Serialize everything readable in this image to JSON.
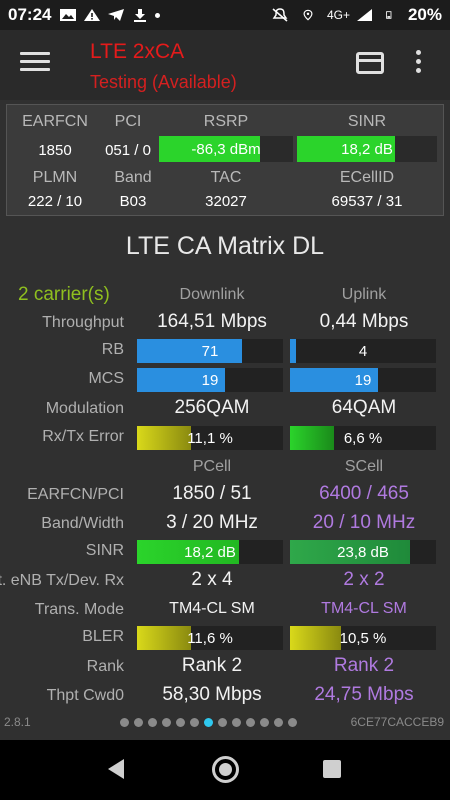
{
  "status_bar": {
    "time": "07:24",
    "network": "4G+",
    "battery": "20%",
    "icons": [
      "image-icon",
      "warning-icon",
      "telegram-icon",
      "download-icon",
      "dot-icon",
      "mute-icon",
      "location-icon",
      "signal-icon",
      "battery-icon"
    ]
  },
  "app_bar": {
    "title": "LTE 2xCA",
    "subtitle": "Testing (Available)",
    "title_color": "#e51b1b"
  },
  "panel": {
    "earfcn_label": "EARFCN",
    "earfcn": "1850",
    "pci_label": "PCI",
    "pci": "051 / 0",
    "rsrp_label": "RSRP",
    "rsrp": "-86,3 dBm",
    "rsrp_level": 0.75,
    "sinr_label": "SINR",
    "sinr": "18,2 dB",
    "sinr_level": 0.7,
    "plmn_label": "PLMN",
    "plmn": "222 / 10",
    "band_label": "Band",
    "band": "B03",
    "tac_label": "TAC",
    "tac": "32027",
    "ecellid_label": "ECellID",
    "ecellid": "69537 / 31"
  },
  "matrix": {
    "title": "LTE CA Matrix DL",
    "carriers": "2 carrier(s)",
    "col_downlink": "Downlink",
    "col_uplink": "Uplink",
    "throughput_label": "Throughput",
    "throughput_dl": "164,51 Mbps",
    "throughput_ul": "0,44 Mbps",
    "rb_label": "RB",
    "rb_dl": "71",
    "rb_dl_level": 0.72,
    "rb_ul": "4",
    "rb_ul_level": 0.04,
    "mcs_label": "MCS",
    "mcs_dl": "19",
    "mcs_dl_level": 0.6,
    "mcs_ul": "19",
    "mcs_ul_level": 0.6,
    "modulation_label": "Modulation",
    "modulation_dl": "256QAM",
    "modulation_ul": "64QAM",
    "error_label": "Rx/Tx Error",
    "error_dl": "11,1 %",
    "error_dl_level": 0.37,
    "error_ul": "6,6 %",
    "error_ul_level": 0.3,
    "col_pcell": "PCell",
    "col_scell": "SCell",
    "earfcn_pci_label": "EARFCN/PCI",
    "earfcn_pci_p": "1850 / 51",
    "earfcn_pci_s": "6400 / 465",
    "band_width_label": "Band/Width",
    "band_width_p": "3 / 20 MHz",
    "band_width_s": "20 / 10 MHz",
    "sinr_label": "SINR",
    "sinr_p": "18,2 dB",
    "sinr_p_level": 0.7,
    "sinr_s": "23,8 dB",
    "sinr_s_level": 0.82,
    "enb_label": "Ant. eNB Tx/Dev. Rx",
    "enb_p": "2 x 4",
    "enb_s": "2 x 2",
    "trans_mode_label": "Trans. Mode",
    "trans_mode_p": "TM4-CL SM",
    "trans_mode_s": "TM4-CL SM",
    "bler_label": "BLER",
    "bler_p": "11,6 %",
    "bler_p_level": 0.37,
    "bler_s": "10,5 %",
    "bler_s_level": 0.35,
    "rank_label": "Rank",
    "rank_p": "Rank 2",
    "rank_s": "Rank 2",
    "cwd0_label": "Thpt Cwd0",
    "cwd0_p": "58,30 Mbps",
    "cwd0_s": "24,75 Mbps"
  },
  "footer": {
    "version": "2.8.1",
    "device_id": "6CE77CACCEB9",
    "page_count": 13,
    "active_page": 7
  },
  "colors": {
    "green": "#2bd42b",
    "blue": "#2a8fe0",
    "yellow": "#d9d91a",
    "purple": "#b07ae0"
  }
}
